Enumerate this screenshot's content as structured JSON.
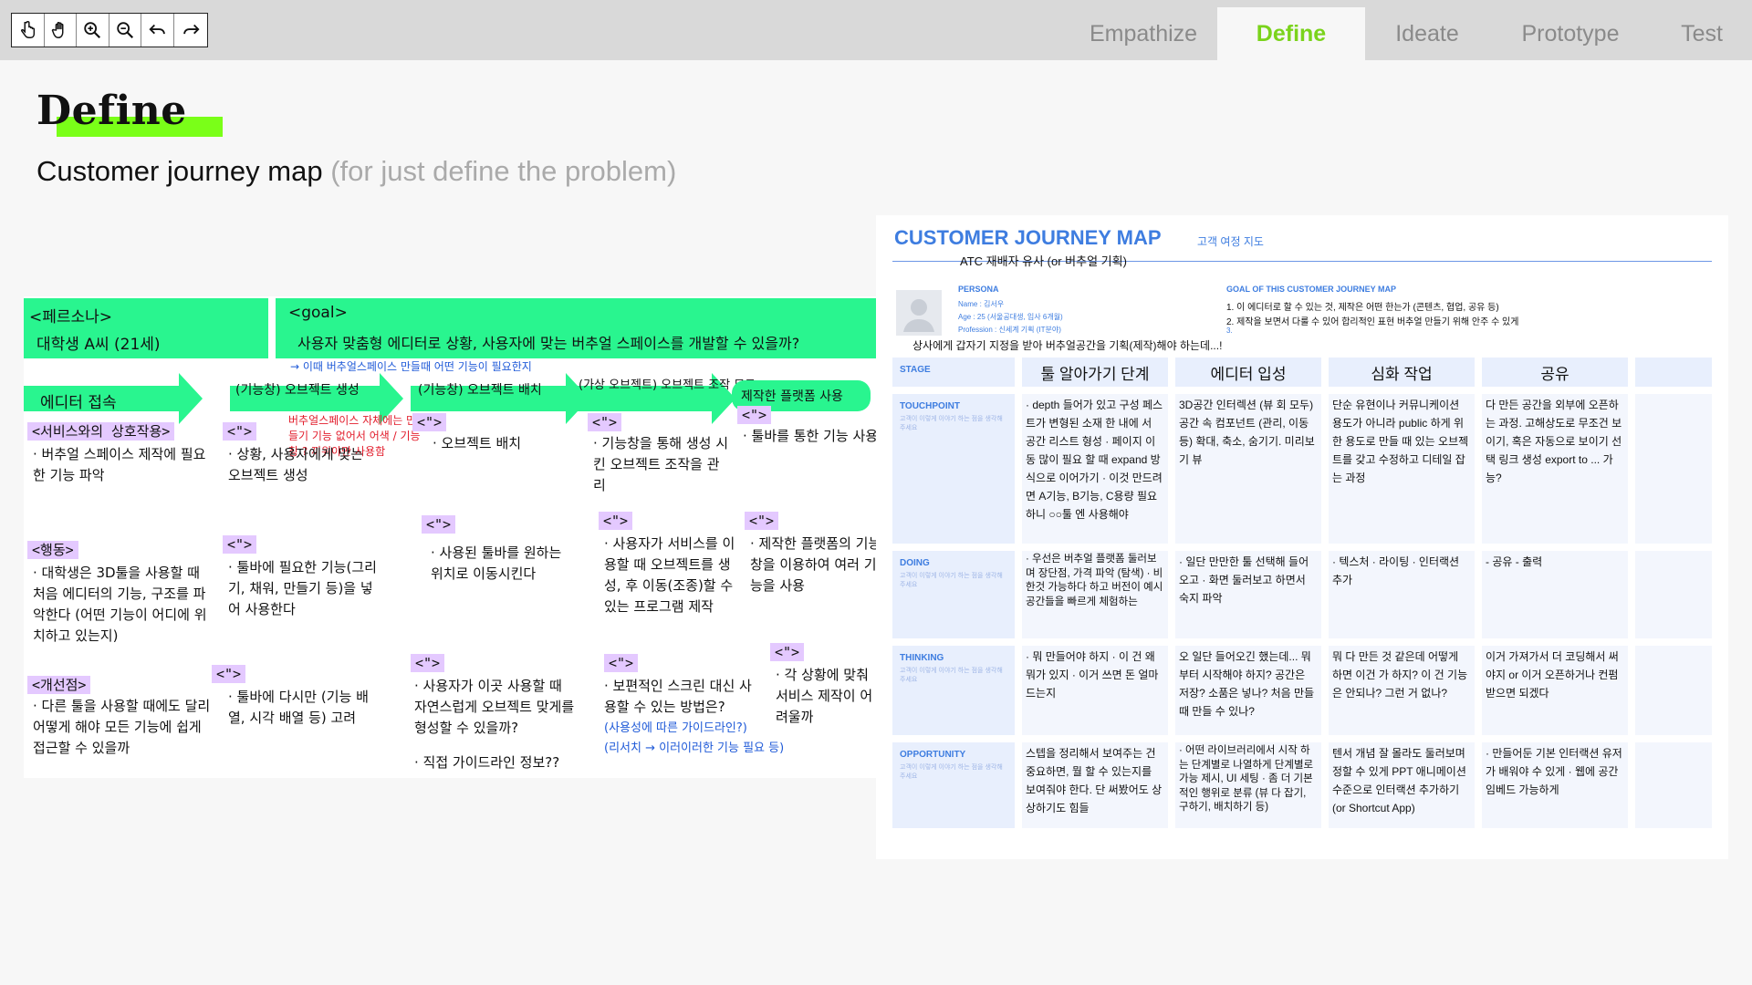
{
  "toolbar": {
    "tools": [
      {
        "name": "pointer-icon"
      },
      {
        "name": "hand-icon"
      },
      {
        "name": "zoom-in-icon"
      },
      {
        "name": "zoom-out-icon"
      },
      {
        "name": "undo-icon"
      },
      {
        "name": "redo-icon"
      }
    ]
  },
  "tabs": [
    {
      "label": "Empathize",
      "active": false
    },
    {
      "label": "Define",
      "active": true
    },
    {
      "label": "Ideate",
      "active": false
    },
    {
      "label": "Prototype",
      "active": false
    },
    {
      "label": "Test",
      "active": false
    }
  ],
  "page": {
    "title": "Define",
    "subtitle_main": "Customer journey map",
    "subtitle_muted": "(for just define the problem)",
    "accent": "#7ad31b",
    "highlight": "#7aff18"
  },
  "board": {
    "persona_label": "<페르소나>",
    "persona_value": "대학생 A씨 (21세)",
    "goal_label": "<goal>",
    "goal_text": "사용자 맞춤형 에디터로 상황, 사용자에 맞는 버추얼 스페이스를 개발할 수 있을까?",
    "steps": [
      "에디터 접속",
      "(기능창) 오브젝트 생성",
      "(기능창) 오브젝트 배치",
      "(가상 오브젝트) 오브젝트 조작 모드",
      "제작한 플랫폼 사용"
    ],
    "blue_note": "→ 이때 버추얼스페이스 만들때 어떤 기능이 필요한지",
    "red_note": "버추얼스페이스 자체에는 만들기 기능 없어서 어색 / 기능창 ? 끼워야만 사용함",
    "rows": {
      "service_label": "<서비스와의 상호작용>",
      "service": [
        "· 버추얼 스페이스 제작에 필요한 기능 파악",
        "· 상황, 사용자에게 맞는 오브젝트 생성",
        "· 오브젝트 배치",
        "· 기능창을 통해 생성 시킨 오브젝트 조작을 관리",
        "· 툴바를 통한 기능 사용"
      ],
      "action_label": "<행동>",
      "action": [
        "· 대학생은 3D툴을 사용할 때 처음 에디터의 기능, 구조를 파악한다 (어떤 기능이 어디에 위치하고 있는지)",
        "· 툴바에 필요한 기능(그리기, 채워, 만들기 등)을 넣어 사용한다",
        "· 사용된 툴바를 원하는 위치로 이동시킨다",
        "· 사용자가 서비스를 이용할 때 오브젝트를 생성, 후 이동(조종)할 수 있는 프로그램 제작",
        "· 제작한 플랫폼의 기능창을 이용하여 여러 기능을 사용"
      ],
      "thought_label": "<개선점>",
      "thought": [
        "· 다른 툴을 사용할 때에도 달리 어떻게 해야 모든 기능에 쉽게 접근할 수 있을까",
        "· 툴바에 다시만 (기능 배열, 시각 배열 등) 고려",
        "· 사용자가 이곳 사용할 때 자연스럽게 오브젝트 맞게를 형성할 수 있을까?",
        "· 직접 가이드라인 정보??",
        "· 보편적인 스크린 대신 사용할 수 있는 방법은?",
        "(사용성에 따른 가이드라인?)",
        "(리서치 → 이러이러한 기능 필요 등)",
        "· 각 상황에 맞춰 서비스 제작이 어려울까"
      ]
    },
    "tag": "<\">"
  },
  "cjm": {
    "title": "CUSTOMER JOURNEY MAP",
    "subtitle": "고객 여정 지도",
    "note_top": "ATC 재배자 유사 (or 버추얼 기획)",
    "persona_heading": "PERSONA",
    "persona_name": "Name : 김서우",
    "persona_age": "Age : 25 (서울공대생, 입사 6개월)",
    "persona_prof": "Profession : 신세계 기획 (IT분야)",
    "persona_note": "상사에게 갑자기 지정을 받아 버추얼공간을 기획(제작)해야 하는데...!",
    "goal_heading": "GOAL OF THIS CUSTOMER JOURNEY MAP",
    "goals": [
      "1. 이 에디터로 할 수 있는 것, 제작은 어떤 한는가 (콘텐츠, 협업, 공유 등)",
      "2. 제작을 보면서 다룰 수 있어 합리적인 표현 버추얼 만들기 위해 안주 수 있게",
      "3."
    ],
    "rows": [
      "STAGE",
      "TOUCHPOINT",
      "DOING",
      "THINKING",
      "OPPORTUNITY"
    ],
    "row_hint": "고객이 이렇게 이야기 하는 점을 생각해 주세요",
    "stages": [
      "툴 알아가기 단계",
      "에디터 입성",
      "심화 작업",
      "공유",
      ""
    ],
    "touchpoint": [
      "· depth 들어가 있고 구성 페스트가 변형된 소재 한 내에 서 공간 리스트 형성 · 페이지 이동 많이 필요 할 때 expand 방식으로 이어가기 · 이것 만드려면 A기능, B기능, C용량 필요하니 ○○툴 엔 사용해야",
      "3D공간 인터렉션 (뷰 회 모두) 공간 속 컴포넌트 (관리, 이동 등) 확대, 축소, 숨기기. 미리보기 뷰",
      "단순 유현이나 커뮤니케이션 용도가 아니라 public 하게 위한 용도로 만들 때 있는 오브젝트를 갖고 수정하고 디테일 잡는 과정",
      "다 만든 공간을 외부에 오픈하는 과정. 고해상도로 무조건 보이기, 혹은 자동으로 보이기 선택 링크 생성 export to ... 가능?",
      ""
    ],
    "doing": [
      "· 우선은 버추얼 플랫폼 둘러보며 장단점, 가격 파악 (탐색) · 비한것 가능하다 하고 버전이 예시 공간들을 빠르게 체험하는",
      "· 일단 만만한 툴 선택해 들어오고 · 화면 둘러보고 하면서 숙지 파악",
      "· 텍스처 · 라이팅 · 인터랙션 추가",
      "- 공유 - 출력",
      ""
    ],
    "thinking": [
      "· 뭐 만들어야 하지 · 이 건 왜 뭐가 있지 · 이거 쓰면 돈 얼마 드는지",
      "오 일단 들어오긴 했는데... 뭐부터 시작해야 하지? 공간은 저장? 소품은 넣나? 처음 만들 때 만들 수 있나?",
      "뭐 다 만든 것 같은데 어떻게 하면 이건 가 하지? 이 건 기능은 안되나? 그런 거 없나?",
      "이거 가져가서 더 코딩해서 써야지 or 이거 오픈하거나 컨펌받으면 되겠다",
      ""
    ],
    "opportunity": [
      "스텝을 정리해서 보여주는 건 중요하면, 뭘 할 수 있는지를 보여줘야 한다. 단 써봤어도 상상하기도 힘들",
      "· 어떤 라이브러리에서 시작 하는 단계별로 나열하게 단계별로 가능 제시, UI 세팅 · 좀 더 기본적인 행위로 분류 (뷰 다 잡기, 구하기, 배치하기 등)",
      "텐서 개념 잘 몰라도 둘러보며 정할 수 있게 PPT 애니메이션 수준으로 인터랙션 추가하기 (or Shortcut App)",
      "· 만들어둔 기본 인터랙션 유저가 배워야 수 있게 · 웹에 공간 임베드 가능하게",
      ""
    ]
  }
}
